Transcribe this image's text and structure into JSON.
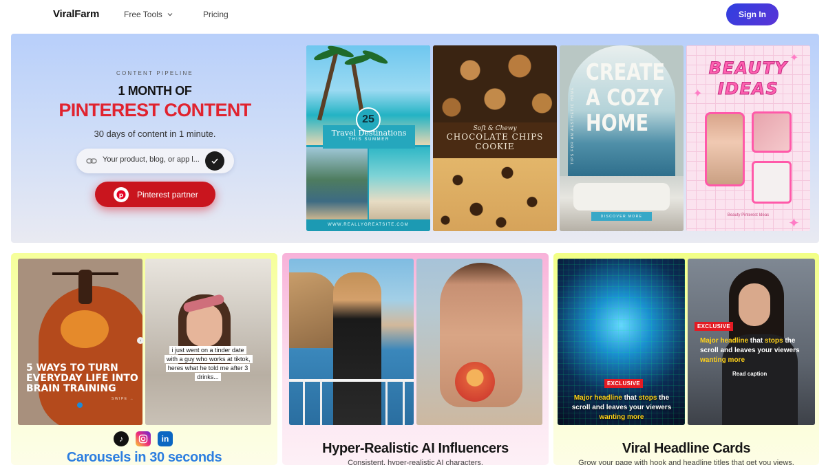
{
  "nav": {
    "logo": "ViralFarm",
    "free_tools": "Free Tools",
    "pricing": "Pricing",
    "sign_in": "Sign In"
  },
  "hero": {
    "kicker": "CONTENT PIPELINE",
    "title_line1": "1 MONTH OF",
    "title_line2": "PINTEREST CONTENT",
    "subtitle": "30 days of content in 1 minute.",
    "input_placeholder": "Your product, blog, or app l...",
    "partner_button": "Pinterest partner",
    "accent_color": "#e0232f"
  },
  "hero_cards": {
    "travel": {
      "number": "25",
      "title": "Travel Destinations",
      "subtitle": "THIS SUMMER",
      "footer": "WWW.REALLYGREATSITE.COM"
    },
    "cookie": {
      "script_line": "Soft & Chewy",
      "title_line1": "CHOCOLATE CHIPS",
      "title_line2": "COOKIE"
    },
    "cozy": {
      "title_line1": "CREATE",
      "title_line2": "A COZY",
      "title_line3": "HOME",
      "side_text": "TIPS FOR AN AESTHETIC HOME",
      "button": "DISCOVER MORE"
    },
    "beauty": {
      "title_line1": "BEAUTY",
      "title_line2": "IDEAS",
      "caption": "Beauty Pinterest Ideas"
    }
  },
  "features": {
    "carousels": {
      "slide1_text": "5 WAYS TO TURN EVERYDAY LIFE INTO BRAIN TRAINING",
      "slide1_swipe": "SWIPE →",
      "slide2_caption": "i just went on a tinder date with a guy who works at tiktok, heres what he told me after 3 drinks...",
      "social_icons": [
        "tiktok-icon",
        "instagram-icon",
        "linkedin-icon"
      ],
      "title": "Carousels in 30 seconds",
      "title_color": "#2c7ee0"
    },
    "influencers": {
      "title": "Hyper-Realistic AI Influencers",
      "subtitle": "Consistent, hyper-realistic AI characters."
    },
    "headlines": {
      "card1_badge": "EXCLUSIVE",
      "card1_headline_a": "Major headline",
      "card1_headline_b": " that ",
      "card1_headline_c": "stops",
      "card1_headline_d": " the scroll and leaves your viewers ",
      "card1_headline_e": "wanting more",
      "card2_badge": "EXCLUSIVE",
      "card2_headline_a": "Major headline",
      "card2_headline_b": " that ",
      "card2_headline_c": "stops",
      "card2_headline_d": " the scroll and leaves your viewers ",
      "card2_headline_e": "wanting more",
      "card2_read_caption": "Read caption",
      "title": "Viral Headline Cards",
      "subtitle": "Grow your page with hook and headline titles that get you views."
    }
  }
}
